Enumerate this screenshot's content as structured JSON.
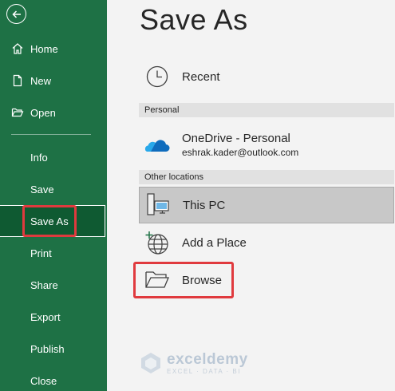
{
  "sidebar": {
    "items": [
      {
        "label": "Home",
        "icon": "home-icon"
      },
      {
        "label": "New",
        "icon": "new-document-icon"
      },
      {
        "label": "Open",
        "icon": "open-folder-icon"
      },
      {
        "label": "Info"
      },
      {
        "label": "Save"
      },
      {
        "label": "Save As"
      },
      {
        "label": "Print"
      },
      {
        "label": "Share"
      },
      {
        "label": "Export"
      },
      {
        "label": "Publish"
      },
      {
        "label": "Close"
      }
    ],
    "active": "Save As"
  },
  "main": {
    "title": "Save As",
    "recent_label": "Recent",
    "personal_header": "Personal",
    "onedrive": {
      "name": "OneDrive - Personal",
      "email": "eshrak.kader@outlook.com"
    },
    "other_header": "Other locations",
    "this_pc_label": "This PC",
    "add_place_label": "Add a Place",
    "browse_label": "Browse"
  },
  "watermark": {
    "name": "exceldemy",
    "tagline": "EXCEL · DATA · BI"
  },
  "colors": {
    "sidebar_bg": "#1e7145",
    "active_bg": "#0f5a32",
    "highlight": "#e03a3e",
    "main_bg": "#f3f3f3"
  }
}
